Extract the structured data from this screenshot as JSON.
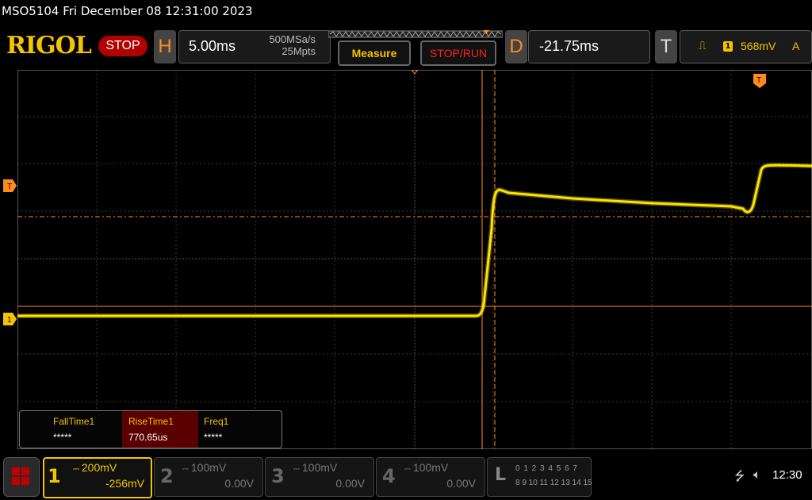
{
  "title_bar": {
    "text": "MSO5104  Fri December 08 12:31:00 2023"
  },
  "logo": "RIGOL",
  "run_state": "STOP",
  "horizontal": {
    "tag": "H",
    "timebase": "5.00ms",
    "sample_rate": "500MSa/s",
    "memory_depth": "25Mpts"
  },
  "buttons": {
    "measure": "Measure",
    "stop_run": "STOP/RUN"
  },
  "delay": {
    "tag": "D",
    "value": "-21.75ms"
  },
  "trigger": {
    "tag": "T",
    "edge_icon": "rising-edge-icon",
    "edge_glyph": "⎍",
    "channel": "1",
    "level": "568mV",
    "mode": "A"
  },
  "markers": {
    "trigger_level": "T",
    "channel1": "1",
    "trigger_position": "T"
  },
  "measurements": [
    {
      "name": "FallTime1",
      "value": "*****"
    },
    {
      "name": "RiseTime1",
      "value": "770.65us"
    },
    {
      "name": "Freq1",
      "value": "*****"
    }
  ],
  "channels": [
    {
      "num": "1",
      "scale": "200mV",
      "offset": "-256mV",
      "color": "#f5c400",
      "active": true
    },
    {
      "num": "2",
      "scale": "100mV",
      "offset": "0.00V",
      "active": false
    },
    {
      "num": "3",
      "scale": "100mV",
      "offset": "0.00V",
      "active": false
    },
    {
      "num": "4",
      "scale": "100mV",
      "offset": "0.00V",
      "active": false
    }
  ],
  "logic": {
    "letter": "L",
    "row1": "0 1 2 3  4 5 6 7",
    "row2": "8 9 10 11 12 13 14 15"
  },
  "status": {
    "usb_icon": "usb-icon",
    "speaker_icon": "speaker-muted-icon",
    "time": "12:30"
  },
  "colors": {
    "trace": "#f5c400",
    "accent": "#ff8c1a",
    "stop": "#b00000"
  }
}
